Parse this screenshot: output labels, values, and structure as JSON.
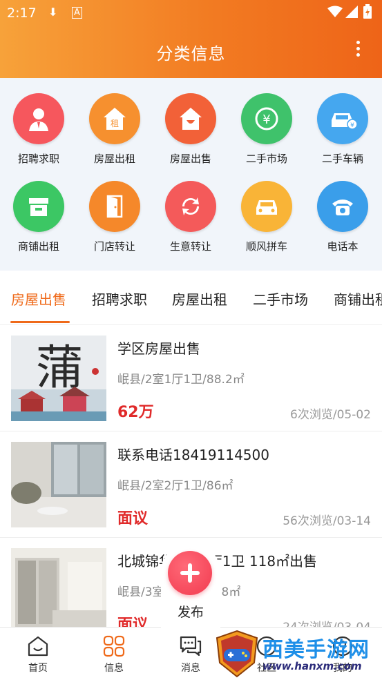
{
  "status": {
    "time": "2:17",
    "icons": [
      "download-icon",
      "a-icon",
      "wifi-icon",
      "signal-icon",
      "battery-icon"
    ]
  },
  "header": {
    "title": "分类信息",
    "more_icon": "more-vert-icon"
  },
  "categories": [
    {
      "label": "招聘求职",
      "icon": "person-icon",
      "color": "#f6575d"
    },
    {
      "label": "房屋出租",
      "icon": "house-rent-icon",
      "color": "#f6902f"
    },
    {
      "label": "房屋出售",
      "icon": "house-sale-icon",
      "color": "#f26138"
    },
    {
      "label": "二手市场",
      "icon": "yuan-recycle-icon",
      "color": "#3fc26b"
    },
    {
      "label": "二手车辆",
      "icon": "car-yuan-icon",
      "color": "#45a7ef"
    },
    {
      "label": "商铺出租",
      "icon": "shop-icon",
      "color": "#3cc764"
    },
    {
      "label": "门店转让",
      "icon": "door-icon",
      "color": "#f5882a"
    },
    {
      "label": "生意转让",
      "icon": "transfer-icon",
      "color": "#f45a5a"
    },
    {
      "label": "顺风拼车",
      "icon": "car-icon",
      "color": "#f9b437"
    },
    {
      "label": "电话本",
      "icon": "phone-icon",
      "color": "#3a9eea"
    }
  ],
  "tabs": [
    "房屋出售",
    "招聘求职",
    "房屋出租",
    "二手市场",
    "商铺出租"
  ],
  "active_tab": "房屋出售",
  "listings": [
    {
      "title": "学区房屋出售",
      "subtitle": "岷县/2室1厅1卫/88.2㎡",
      "price": "62万",
      "meta": "6次浏览/05-02"
    },
    {
      "title": "联系电话18419114500",
      "subtitle": "岷县/2室2厅1卫/86㎡",
      "price": "面议",
      "meta": "56次浏览/03-14"
    },
    {
      "title": "北城锦华 3室1厅1卫 118㎡出售",
      "subtitle": "岷县/3室2厅1卫/118㎡",
      "price": "面议",
      "meta": "24次浏览/03-04"
    }
  ],
  "fab": {
    "label": "发布"
  },
  "bottom_nav": [
    {
      "label": "首页",
      "icon": "home-icon",
      "active": false
    },
    {
      "label": "信息",
      "icon": "grid-icon",
      "active": true
    },
    {
      "label": "消息",
      "icon": "chat-icon",
      "active": false
    },
    {
      "label": "社区",
      "icon": "community-icon",
      "active": false
    },
    {
      "label": "我的",
      "icon": "profile-icon",
      "active": false
    }
  ],
  "watermark": {
    "text": "西美手游网",
    "url": "www.hanxm.com"
  },
  "colors": {
    "accent": "#ef6a1a",
    "price": "#e02a2a"
  }
}
